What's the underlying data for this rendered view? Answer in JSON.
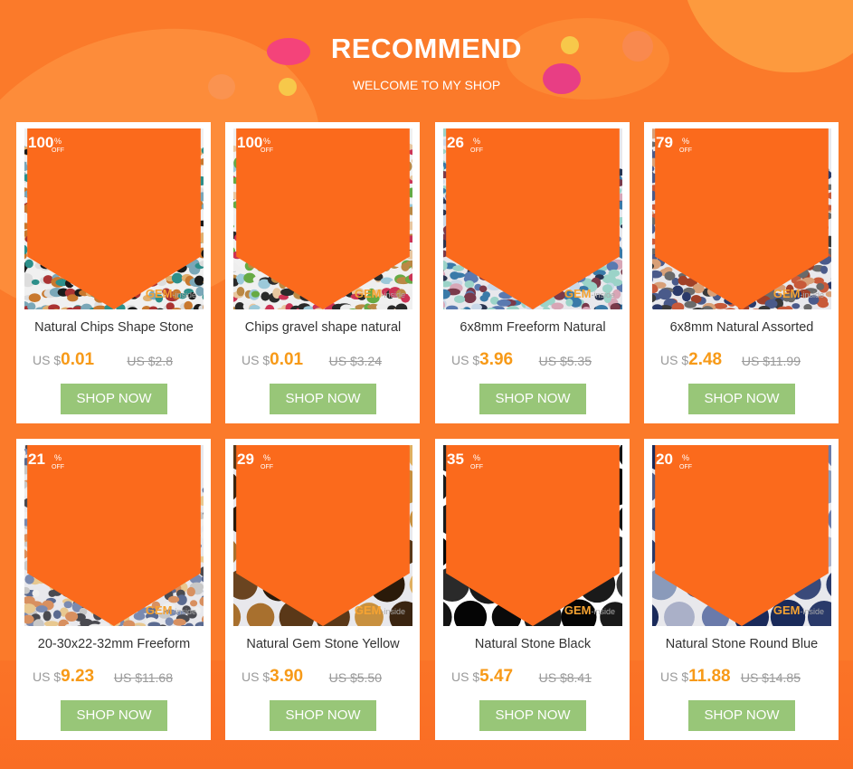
{
  "header": {
    "title": "RECOMMEND",
    "subtitle": "WELCOME TO MY SHOP"
  },
  "colors": {
    "background": "#fb7a2a",
    "button": "#98c678",
    "price": "#f79a18",
    "badge": "#fb6a1c"
  },
  "products": [
    {
      "discount": "100",
      "pct": "%",
      "off": "OFF",
      "name": "Natural Chips Shape Stone",
      "currency": "US $",
      "price": "0.01",
      "old_price": "US $2.8",
      "button": "SHOP NOW",
      "logo": "GEM",
      "logo_sub": "-inside"
    },
    {
      "discount": "100",
      "pct": "%",
      "off": "OFF",
      "name": "Chips gravel shape natural",
      "currency": "US $",
      "price": "0.01",
      "old_price": "US $3.24",
      "button": "SHOP NOW",
      "logo": "GEM",
      "logo_sub": "-inside"
    },
    {
      "discount": "26",
      "pct": "%",
      "off": "OFF",
      "name": "6x8mm Freeform Natural",
      "currency": "US $",
      "price": "3.96",
      "old_price": "US $5.35",
      "button": "SHOP NOW",
      "logo": "GEM",
      "logo_sub": "-inside"
    },
    {
      "discount": "79",
      "pct": "%",
      "off": "OFF",
      "name": "6x8mm Natural Assorted",
      "currency": "US $",
      "price": "2.48",
      "old_price": "US $11.99",
      "button": "SHOP NOW",
      "logo": "GEM",
      "logo_sub": "-inside"
    },
    {
      "discount": "21",
      "pct": "%",
      "off": "OFF",
      "name": "20-30x22-32mm Freeform",
      "currency": "US $",
      "price": "9.23",
      "old_price": "US $11.68",
      "button": "SHOP NOW",
      "logo": "GEM",
      "logo_sub": "-inside"
    },
    {
      "discount": "29",
      "pct": "%",
      "off": "OFF",
      "name": "Natural Gem Stone Yellow",
      "currency": "US $",
      "price": "3.90",
      "old_price": "US $5.50",
      "button": "SHOP NOW",
      "logo": "GEM",
      "logo_sub": "-inside"
    },
    {
      "discount": "35",
      "pct": "%",
      "off": "OFF",
      "name": "Natural Stone Black",
      "currency": "US $",
      "price": "5.47",
      "old_price": "US $8.41",
      "button": "SHOP NOW",
      "logo": "GEM",
      "logo_sub": "-inside"
    },
    {
      "discount": "20",
      "pct": "%",
      "off": "OFF",
      "name": "Natural Stone Round Blue",
      "currency": "US $",
      "price": "11.88",
      "old_price": "US $14.85",
      "button": "SHOP NOW",
      "logo": "GEM",
      "logo_sub": "-inside"
    }
  ]
}
